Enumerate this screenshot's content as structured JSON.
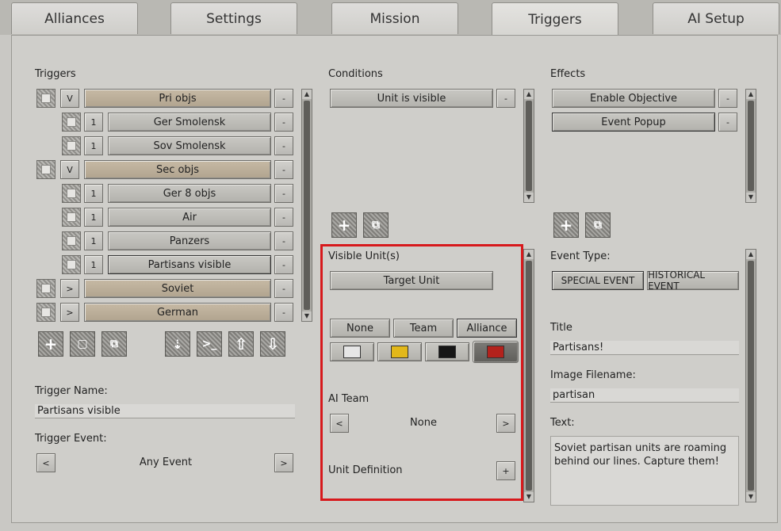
{
  "tabs": [
    "Alliances",
    "Settings",
    "Mission",
    "Triggers",
    "AI Setup"
  ],
  "triggers": {
    "title": "Triggers",
    "rows": [
      {
        "tag": "V",
        "label": "Pri objs",
        "remove": "-"
      },
      {
        "tag": "1",
        "label": "Ger Smolensk",
        "remove": "-"
      },
      {
        "tag": "1",
        "label": "Sov Smolensk",
        "remove": "-"
      },
      {
        "tag": "V",
        "label": "Sec objs",
        "remove": "-"
      },
      {
        "tag": "1",
        "label": "Ger 8 objs",
        "remove": "-"
      },
      {
        "tag": "1",
        "label": "Air",
        "remove": "-"
      },
      {
        "tag": "1",
        "label": "Panzers",
        "remove": "-"
      },
      {
        "tag": "1",
        "label": "Partisans visible",
        "remove": "-"
      },
      {
        "tag": ">",
        "label": "Soviet",
        "remove": "-"
      },
      {
        "tag": ">",
        "label": "German",
        "remove": "-"
      }
    ],
    "name_label": "Trigger Name:",
    "name_value": "Partisans visible",
    "event_label": "Trigger Event:",
    "event_value": "Any Event",
    "prev": "<",
    "next": ">"
  },
  "conditions": {
    "title": "Conditions",
    "items": [
      {
        "label": "Unit is visible",
        "remove": "-"
      }
    ]
  },
  "visible_units": {
    "title": "Visible Unit(s)",
    "target_button": "Target Unit",
    "scope_options": [
      "None",
      "Team",
      "Alliance"
    ],
    "colors": [
      "#e6e6e6",
      "#e2b81a",
      "#161616",
      "#b3221c"
    ],
    "ai_team_label": "AI Team",
    "ai_team_value": "None",
    "prev": "<",
    "next": ">",
    "unit_def_label": "Unit Definition",
    "add": "+"
  },
  "effects": {
    "title": "Effects",
    "items": [
      {
        "label": "Enable Objective",
        "remove": "-"
      },
      {
        "label": "Event Popup",
        "remove": "-"
      }
    ],
    "event_type_label": "Event Type:",
    "event_types": [
      "SPECIAL EVENT",
      "HISTORICAL EVENT"
    ],
    "title_label": "Title",
    "title_value": "Partisans!",
    "image_label": "Image Filename:",
    "image_value": "partisan",
    "text_label": "Text:",
    "text_value": "Soviet partisan units are roaming behind our lines. Capture them!"
  }
}
